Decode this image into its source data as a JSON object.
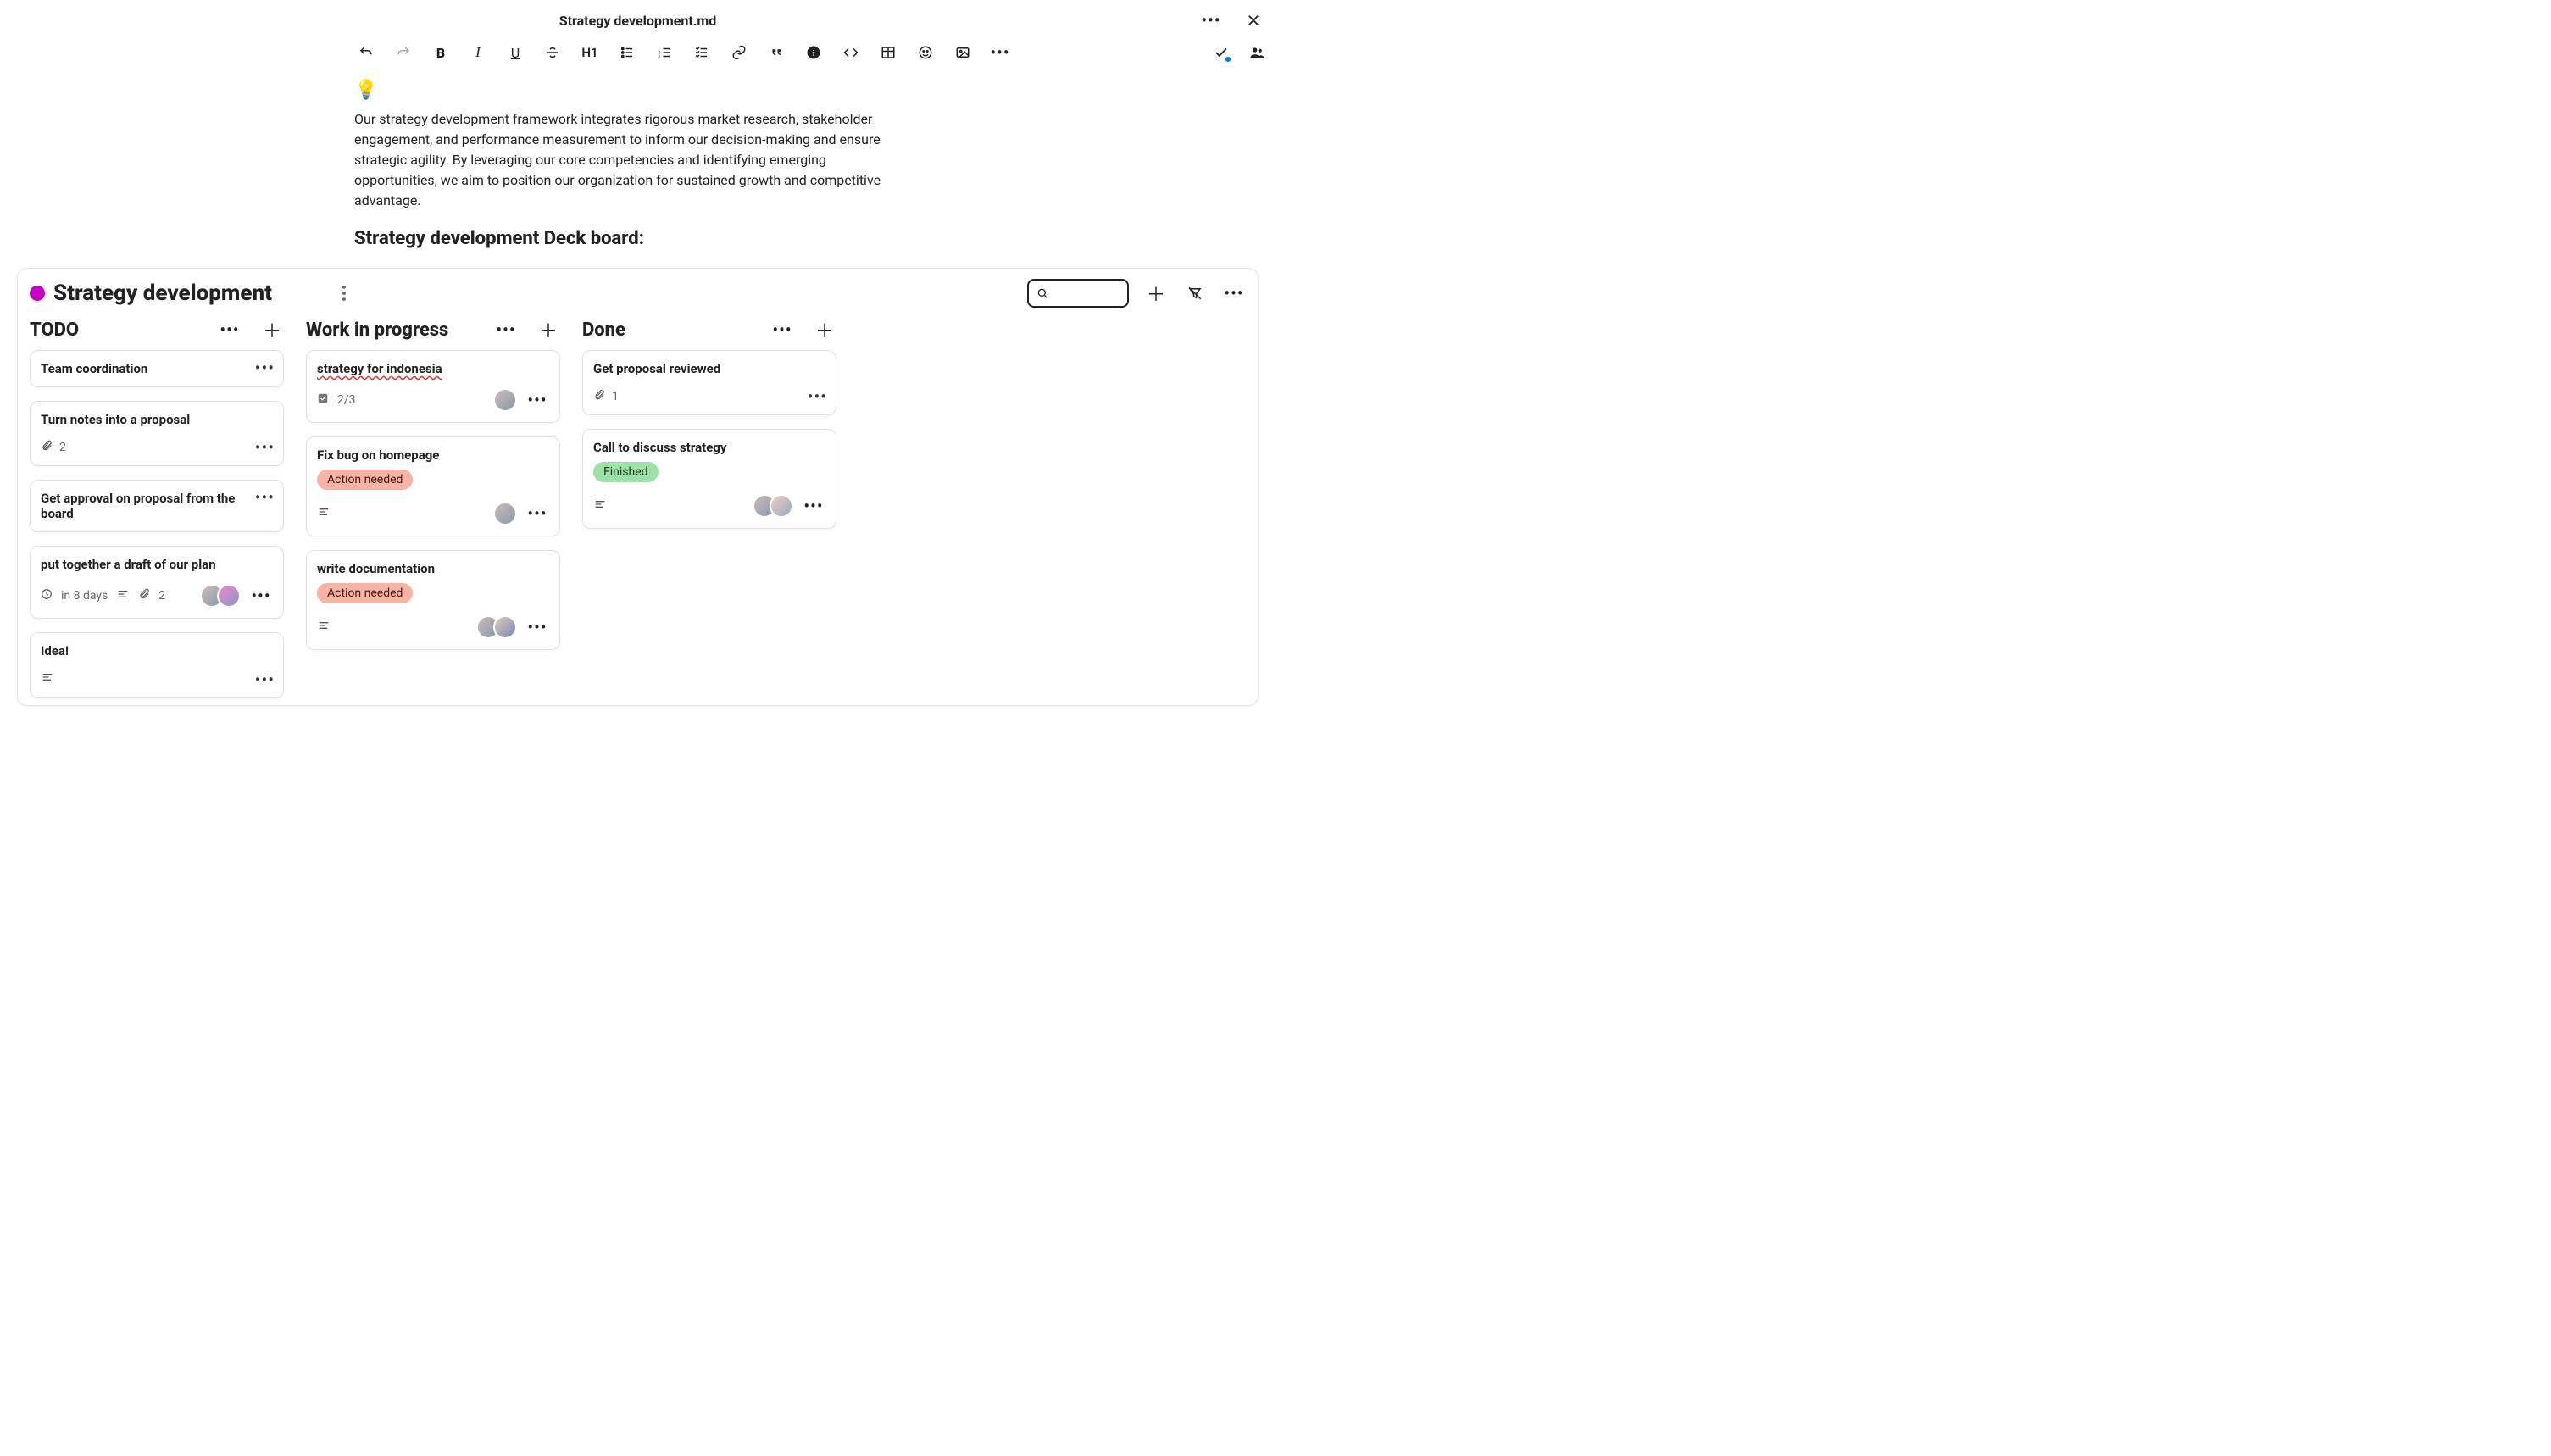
{
  "header": {
    "title": "Strategy development.md"
  },
  "toolbar": {
    "h1": "H1"
  },
  "doc": {
    "emoji": "💡",
    "paragraph": "Our strategy development framework integrates rigorous market research, stakeholder engagement, and performance measurement to inform our decision-making and ensure strategic agility. By leveraging our core competencies and identifying emerging opportunities, we aim to position our organization for sustained growth and competitive advantage.",
    "heading": "Strategy development Deck board:"
  },
  "board": {
    "title": "Strategy development",
    "search_value": ""
  },
  "columns": [
    {
      "title": "TODO",
      "cards": [
        {
          "title": "Team coordination"
        },
        {
          "title": "Turn notes into a proposal",
          "attachments": "2"
        },
        {
          "title": "Get approval on proposal from the board"
        },
        {
          "title": "put together a draft of our plan",
          "due": "in 8 days",
          "attachments": "2",
          "avatars": 2,
          "has_desc": true
        },
        {
          "title": "Idea!",
          "has_desc": true
        }
      ]
    },
    {
      "title": "Work in progress",
      "cards": [
        {
          "title": "strategy for indonesia",
          "checklist": "2/3",
          "avatars": 1,
          "spell": true
        },
        {
          "title": "Fix bug on homepage",
          "label": "Action needed",
          "label_color": "red",
          "avatars": 1,
          "has_desc": true
        },
        {
          "title": "write documentation",
          "label": "Action needed",
          "label_color": "red",
          "avatars": 2,
          "has_desc": true
        }
      ]
    },
    {
      "title": "Done",
      "cards": [
        {
          "title": "Get proposal reviewed",
          "attachments": "1"
        },
        {
          "title": "Call to discuss strategy",
          "label": "Finished",
          "label_color": "green",
          "avatars": 2,
          "has_desc": true
        }
      ]
    }
  ]
}
